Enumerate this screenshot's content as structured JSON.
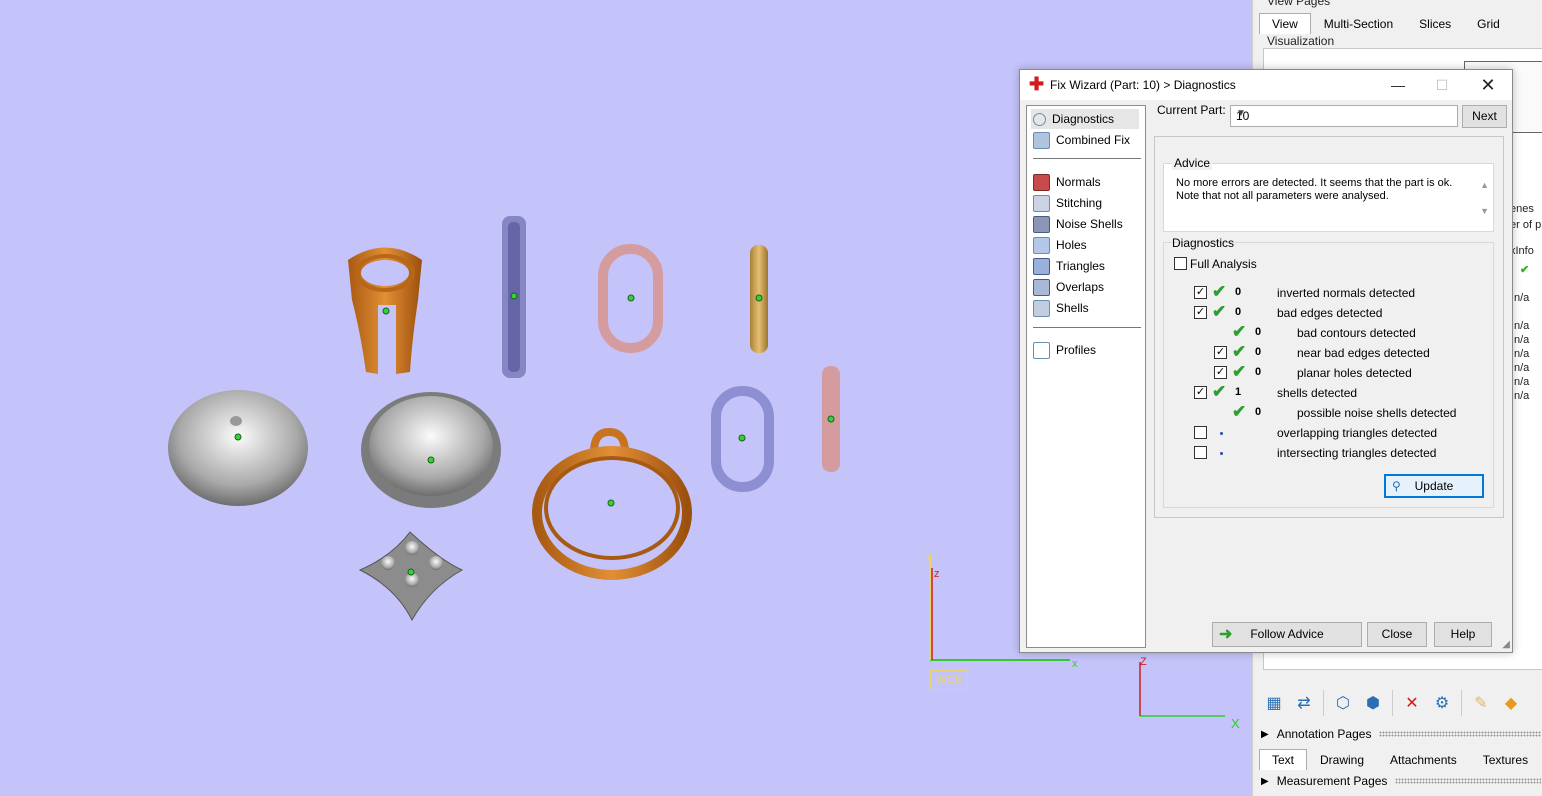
{
  "dialog": {
    "title": "Fix Wizard (Part: 10) > Diagnostics",
    "nav_top": [
      {
        "label": "Diagnostics",
        "icon": "magnifier-icon",
        "selected": true
      },
      {
        "label": "Combined Fix",
        "icon": "combined-fix-icon"
      }
    ],
    "nav_fixes": [
      {
        "label": "Normals",
        "icon": "normals-icon"
      },
      {
        "label": "Stitching",
        "icon": "stitching-icon"
      },
      {
        "label": "Noise Shells",
        "icon": "noise-shells-icon"
      },
      {
        "label": "Holes",
        "icon": "holes-icon"
      },
      {
        "label": "Triangles",
        "icon": "triangles-icon"
      },
      {
        "label": "Overlaps",
        "icon": "overlaps-icon"
      },
      {
        "label": "Shells",
        "icon": "shells-icon"
      }
    ],
    "nav_bottom": [
      {
        "label": "Profiles",
        "icon": "profiles-icon"
      }
    ],
    "current_part_label": "Current Part:",
    "current_part_value": "10",
    "next_label": "Next",
    "advice_title": "Advice",
    "advice_text": "No more errors are detected. It seems that the part is ok. Note that not all parameters were analysed.",
    "diagnostics_title": "Diagnostics",
    "full_analysis_label": "Full Analysis",
    "rows": [
      {
        "checkbox": true,
        "checked": true,
        "status": "ok",
        "count": "0",
        "label": "inverted normals detected",
        "indent": 0
      },
      {
        "checkbox": true,
        "checked": true,
        "status": "ok",
        "count": "0",
        "label": "bad edges detected",
        "indent": 0
      },
      {
        "checkbox": false,
        "checked": false,
        "status": "ok",
        "count": "0",
        "label": "bad contours detected",
        "indent": 1
      },
      {
        "checkbox": true,
        "checked": true,
        "status": "ok",
        "count": "0",
        "label": "near bad edges detected",
        "indent": 1
      },
      {
        "checkbox": true,
        "checked": true,
        "status": "ok",
        "count": "0",
        "label": "planar holes detected",
        "indent": 1
      },
      {
        "checkbox": true,
        "checked": true,
        "status": "ok",
        "count": "1",
        "label": "shells detected",
        "indent": 0
      },
      {
        "checkbox": false,
        "checked": false,
        "status": "ok",
        "count": "0",
        "label": "possible noise shells detected",
        "indent": 1
      },
      {
        "checkbox": true,
        "checked": false,
        "status": "none",
        "count": "",
        "label": "overlapping triangles detected",
        "indent": 0
      },
      {
        "checkbox": true,
        "checked": false,
        "status": "none",
        "count": "",
        "label": "intersecting triangles detected",
        "indent": 0
      }
    ],
    "update_label": "Update",
    "follow_advice_label": "Follow Advice",
    "close_label": "Close",
    "help_label": "Help"
  },
  "right_panel": {
    "header": "View Pages",
    "tabs": [
      "View",
      "Multi-Section",
      "Slices",
      "Grid"
    ],
    "visualization_label": "Visualization",
    "partial_texts": [
      "enes",
      "er of p",
      "xInfo"
    ],
    "info_values": [
      "n/a",
      "n/a",
      "n/a",
      "n/a",
      "n/a",
      "n/a",
      "n/a",
      "n/a"
    ],
    "annotation_pages": "Annotation Pages",
    "bottom_tabs": [
      "Text",
      "Drawing",
      "Attachments",
      "Textures"
    ],
    "measurement_pages": "Measurement Pages"
  },
  "viewport": {
    "wcs_label": "WCS",
    "axis_x": "x",
    "axis_y": "y",
    "axis_z": "z",
    "axis2_x": "X",
    "axis2_z": "Z"
  },
  "colors": {
    "background": "#c4c4fa",
    "orange": "#c8741f",
    "pink": "#d59ca0",
    "gold": "#d1a65a",
    "blue_gray": "#8e8ed2",
    "silver": "#b8b8b8",
    "ok_green": "#2e9e2e"
  }
}
